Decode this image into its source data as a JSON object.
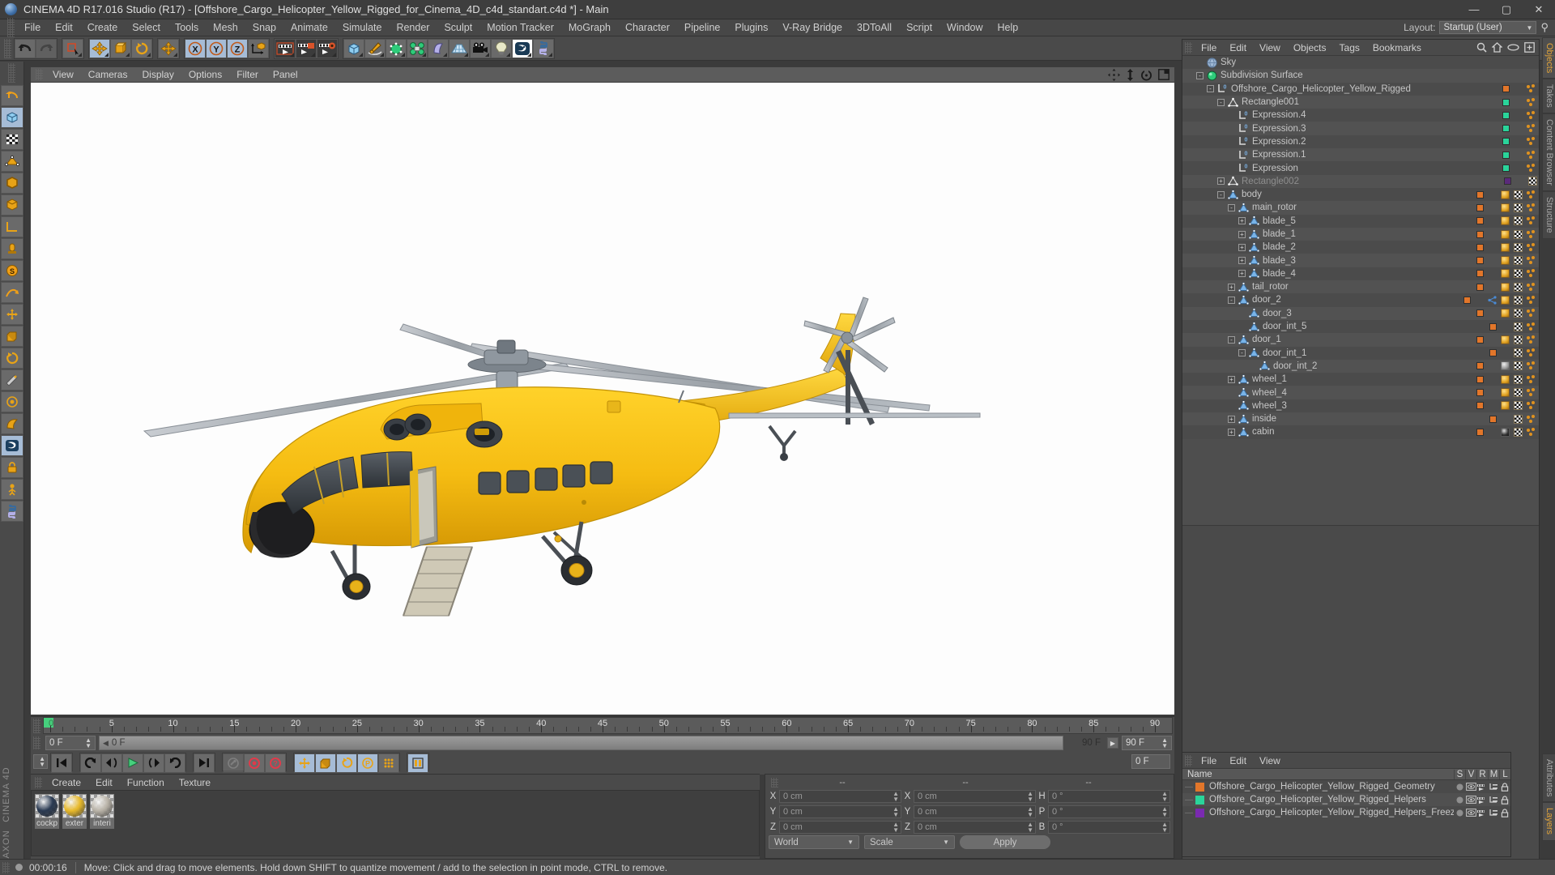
{
  "window": {
    "title": "CINEMA 4D R17.016 Studio (R17) - [Offshore_Cargo_Helicopter_Yellow_Rigged_for_Cinema_4D_c4d_standart.c4d *] - Main",
    "minimize": "—",
    "maximize": "▢",
    "close": "✕"
  },
  "menubar": {
    "items": [
      "File",
      "Edit",
      "Create",
      "Select",
      "Tools",
      "Mesh",
      "Snap",
      "Animate",
      "Simulate",
      "Render",
      "Sculpt",
      "Motion Tracker",
      "MoGraph",
      "Character",
      "Pipeline",
      "Plugins",
      "V-Ray Bridge",
      "3DToAll",
      "Script",
      "Window",
      "Help"
    ],
    "layout_label": "Layout:",
    "layout_value": "Startup (User)"
  },
  "viewport": {
    "menu": [
      "View",
      "Cameras",
      "Display",
      "Options",
      "Filter",
      "Panel"
    ],
    "icons": [
      "move-icon",
      "scale-icon",
      "rotate-icon",
      "panel-icon"
    ]
  },
  "timeline": {
    "ruler_labels": [
      "0",
      "5",
      "10",
      "15",
      "20",
      "25",
      "30",
      "35",
      "40",
      "45",
      "50",
      "55",
      "60",
      "65",
      "70",
      "75",
      "80",
      "85",
      "90"
    ],
    "current_frame": "0 F",
    "scrub_value": "0 F",
    "end_field_left": "90 F",
    "end_field_right": "90 F",
    "right_frame_box": "0 F",
    "transport": [
      "go-to-start-icon",
      "play-backward-icon",
      "previous-frame-icon",
      "play-icon",
      "next-frame-icon",
      "loop-icon",
      "go-to-end-icon"
    ],
    "record_group": [
      "autokey-icon",
      "record-icon",
      "record-parameter-icon"
    ],
    "key_group": [
      "position-key-icon",
      "scale-key-icon",
      "rotation-key-icon",
      "param-key-icon",
      "pla-key-icon",
      "keyframe-selection-icon"
    ]
  },
  "materials": {
    "menu": [
      "Create",
      "Edit",
      "Function",
      "Texture"
    ],
    "items": [
      {
        "name": "cockp",
        "label": "cockpit",
        "color": "#2a3a52"
      },
      {
        "name": "exter",
        "label": "exterior",
        "color": "#e8b92a"
      },
      {
        "name": "interi",
        "label": "interior",
        "color": "#b9b3a8"
      }
    ]
  },
  "coordinates": {
    "header": [
      "--",
      "--",
      "--"
    ],
    "rows": [
      {
        "l1": "X",
        "v1": "0 cm",
        "l2": "X",
        "v2": "0 cm",
        "l3": "H",
        "v3": "0 °"
      },
      {
        "l1": "Y",
        "v1": "0 cm",
        "l2": "Y",
        "v2": "0 cm",
        "l3": "P",
        "v3": "0 °"
      },
      {
        "l1": "Z",
        "v1": "0 cm",
        "l2": "Z",
        "v2": "0 cm",
        "l3": "B",
        "v3": "0 °"
      }
    ],
    "space": "World",
    "mode": "Scale",
    "apply": "Apply"
  },
  "object_manager": {
    "menu": [
      "File",
      "Edit",
      "View",
      "Objects",
      "Tags",
      "Bookmarks"
    ],
    "right_icons": [
      "search-icon",
      "home-icon",
      "eye-icon",
      "new-window-icon"
    ],
    "tree": [
      {
        "label": "Sky",
        "depth": 1,
        "icon": "sky-sphere-icon",
        "expand": "",
        "dim": false,
        "tagcolor": "",
        "tags": []
      },
      {
        "label": "Subdivision Surface",
        "depth": 1,
        "icon": "subdivision-icon",
        "expand": "-",
        "dim": false,
        "tagcolor": "",
        "tags": []
      },
      {
        "label": "Offshore_Cargo_Helicopter_Yellow_Rigged",
        "depth": 2,
        "icon": "null-l0-icon",
        "expand": "-",
        "dim": false,
        "tagcolor": "#e2762a",
        "tags": [
          "dots"
        ]
      },
      {
        "label": "Rectangle001",
        "depth": 3,
        "icon": "spline-triangle-icon",
        "expand": "-",
        "dim": false,
        "tagcolor": "#2ad49a",
        "tags": [
          "dots"
        ]
      },
      {
        "label": "Expression.4",
        "depth": 4,
        "icon": "null-l0-icon",
        "expand": "",
        "dim": false,
        "tagcolor": "#2ad49a",
        "tags": [
          "dots"
        ]
      },
      {
        "label": "Expression.3",
        "depth": 4,
        "icon": "null-l0-icon",
        "expand": "",
        "dim": false,
        "tagcolor": "#2ad49a",
        "tags": [
          "dots"
        ]
      },
      {
        "label": "Expression.2",
        "depth": 4,
        "icon": "null-l0-icon",
        "expand": "",
        "dim": false,
        "tagcolor": "#2ad49a",
        "tags": [
          "dots"
        ]
      },
      {
        "label": "Expression.1",
        "depth": 4,
        "icon": "null-l0-icon",
        "expand": "",
        "dim": false,
        "tagcolor": "#2ad49a",
        "tags": [
          "dots"
        ]
      },
      {
        "label": "Expression",
        "depth": 4,
        "icon": "null-l0-icon",
        "expand": "",
        "dim": false,
        "tagcolor": "#2ad49a",
        "tags": [
          "dots"
        ]
      },
      {
        "label": "Rectangle002",
        "depth": 3,
        "icon": "spline-triangle-icon",
        "expand": "+",
        "dim": true,
        "tagcolor": "#5a2a7a",
        "tags": [
          "chk"
        ]
      },
      {
        "label": "body",
        "depth": 3,
        "icon": "mesh-triangle-icon",
        "expand": "-",
        "dim": false,
        "tagcolor": "#e2762a",
        "tags": [
          "mball",
          "chk",
          "dots"
        ]
      },
      {
        "label": "main_rotor",
        "depth": 4,
        "icon": "mesh-triangle-icon",
        "expand": "-",
        "dim": false,
        "tagcolor": "#e2762a",
        "tags": [
          "mball",
          "chk",
          "dots"
        ]
      },
      {
        "label": "blade_5",
        "depth": 5,
        "icon": "mesh-triangle-icon",
        "expand": "+",
        "dim": false,
        "tagcolor": "#e2762a",
        "tags": [
          "mball",
          "chk",
          "dots"
        ]
      },
      {
        "label": "blade_1",
        "depth": 5,
        "icon": "mesh-triangle-icon",
        "expand": "+",
        "dim": false,
        "tagcolor": "#e2762a",
        "tags": [
          "mball",
          "chk",
          "dots"
        ]
      },
      {
        "label": "blade_2",
        "depth": 5,
        "icon": "mesh-triangle-icon",
        "expand": "+",
        "dim": false,
        "tagcolor": "#e2762a",
        "tags": [
          "mball",
          "chk",
          "dots"
        ]
      },
      {
        "label": "blade_3",
        "depth": 5,
        "icon": "mesh-triangle-icon",
        "expand": "+",
        "dim": false,
        "tagcolor": "#e2762a",
        "tags": [
          "mball",
          "chk",
          "dots"
        ]
      },
      {
        "label": "blade_4",
        "depth": 5,
        "icon": "mesh-triangle-icon",
        "expand": "+",
        "dim": false,
        "tagcolor": "#e2762a",
        "tags": [
          "mball",
          "chk",
          "dots"
        ]
      },
      {
        "label": "tail_rotor",
        "depth": 4,
        "icon": "mesh-triangle-icon",
        "expand": "+",
        "dim": false,
        "tagcolor": "#e2762a",
        "tags": [
          "mball",
          "chk",
          "dots"
        ]
      },
      {
        "label": "door_2",
        "depth": 4,
        "icon": "mesh-triangle-icon",
        "expand": "-",
        "dim": false,
        "tagcolor": "#e2762a",
        "tags": [
          "xpr",
          "mball",
          "chk",
          "dots"
        ]
      },
      {
        "label": "door_3",
        "depth": 5,
        "icon": "mesh-triangle-icon",
        "expand": "",
        "dim": false,
        "tagcolor": "#e2762a",
        "tags": [
          "mball",
          "chk",
          "dots"
        ]
      },
      {
        "label": "door_int_5",
        "depth": 5,
        "icon": "mesh-triangle-icon",
        "expand": "",
        "dim": false,
        "tagcolor": "#e2762a",
        "tags": [
          "chk",
          "dots"
        ]
      },
      {
        "label": "door_1",
        "depth": 4,
        "icon": "mesh-triangle-icon",
        "expand": "-",
        "dim": false,
        "tagcolor": "#e2762a",
        "tags": [
          "mball",
          "chk",
          "dots"
        ]
      },
      {
        "label": "door_int_1",
        "depth": 5,
        "icon": "mesh-triangle-icon",
        "expand": "-",
        "dim": false,
        "tagcolor": "#e2762a",
        "tags": [
          "chk",
          "dots"
        ]
      },
      {
        "label": "door_int_2",
        "depth": 6,
        "icon": "mesh-triangle-icon",
        "expand": "",
        "dim": false,
        "tagcolor": "#e2762a",
        "tags": [
          "greyball",
          "chk",
          "dots"
        ]
      },
      {
        "label": "wheel_1",
        "depth": 4,
        "icon": "mesh-triangle-icon",
        "expand": "+",
        "dim": false,
        "tagcolor": "#e2762a",
        "tags": [
          "mball",
          "chk",
          "dots"
        ]
      },
      {
        "label": "wheel_4",
        "depth": 4,
        "icon": "mesh-triangle-icon",
        "expand": "",
        "dim": false,
        "tagcolor": "#e2762a",
        "tags": [
          "mball",
          "chk",
          "dots"
        ]
      },
      {
        "label": "wheel_3",
        "depth": 4,
        "icon": "mesh-triangle-icon",
        "expand": "",
        "dim": false,
        "tagcolor": "#e2762a",
        "tags": [
          "mball",
          "chk",
          "dots"
        ]
      },
      {
        "label": "inside",
        "depth": 4,
        "icon": "mesh-triangle-icon",
        "expand": "+",
        "dim": false,
        "tagcolor": "#e2762a",
        "tags": [
          "chk",
          "dots"
        ]
      },
      {
        "label": "cabin",
        "depth": 4,
        "icon": "mesh-triangle-icon",
        "expand": "+",
        "dim": false,
        "tagcolor": "#e2762a",
        "tags": [
          "blkball",
          "chk",
          "dots"
        ]
      }
    ]
  },
  "layer_manager": {
    "menu": [
      "File",
      "Edit",
      "View"
    ],
    "columns": [
      "Name",
      "S",
      "V",
      "R",
      "M",
      "L"
    ],
    "rows": [
      {
        "name": "Offshore_Cargo_Helicopter_Yellow_Rigged_Geometry",
        "color": "#e2762a"
      },
      {
        "name": "Offshore_Cargo_Helicopter_Yellow_Rigged_Helpers",
        "color": "#2ad49a"
      },
      {
        "name": "Offshore_Cargo_Helicopter_Yellow_Rigged_Helpers_Freeze",
        "color": "#7a2ab0"
      }
    ]
  },
  "right_tabs": [
    "Objects",
    "Takes",
    "Content Browser",
    "Structure",
    "Attributes",
    "Layers"
  ],
  "status": {
    "time": "00:00:16",
    "message": "Move: Click and drag to move elements. Hold down SHIFT to quantize movement / add to the selection in point mode, CTRL to remove."
  },
  "branding": {
    "maxon": "MAXON",
    "cinema4d": "CINEMA 4D"
  }
}
